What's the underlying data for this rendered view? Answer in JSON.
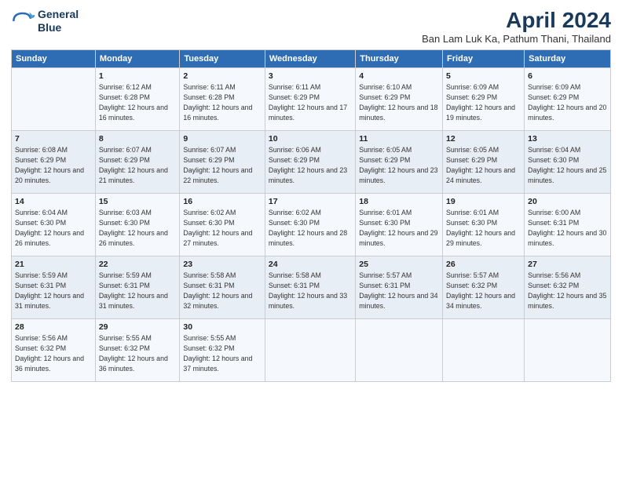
{
  "logo": {
    "line1": "General",
    "line2": "Blue"
  },
  "title": "April 2024",
  "subtitle": "Ban Lam Luk Ka, Pathum Thani, Thailand",
  "days_of_week": [
    "Sunday",
    "Monday",
    "Tuesday",
    "Wednesday",
    "Thursday",
    "Friday",
    "Saturday"
  ],
  "weeks": [
    [
      {
        "day": null,
        "info": null
      },
      {
        "day": "1",
        "sunrise": "6:12 AM",
        "sunset": "6:28 PM",
        "daylight": "12 hours and 16 minutes."
      },
      {
        "day": "2",
        "sunrise": "6:11 AM",
        "sunset": "6:28 PM",
        "daylight": "12 hours and 16 minutes."
      },
      {
        "day": "3",
        "sunrise": "6:11 AM",
        "sunset": "6:29 PM",
        "daylight": "12 hours and 17 minutes."
      },
      {
        "day": "4",
        "sunrise": "6:10 AM",
        "sunset": "6:29 PM",
        "daylight": "12 hours and 18 minutes."
      },
      {
        "day": "5",
        "sunrise": "6:09 AM",
        "sunset": "6:29 PM",
        "daylight": "12 hours and 19 minutes."
      },
      {
        "day": "6",
        "sunrise": "6:09 AM",
        "sunset": "6:29 PM",
        "daylight": "12 hours and 20 minutes."
      }
    ],
    [
      {
        "day": "7",
        "sunrise": "6:08 AM",
        "sunset": "6:29 PM",
        "daylight": "12 hours and 20 minutes."
      },
      {
        "day": "8",
        "sunrise": "6:07 AM",
        "sunset": "6:29 PM",
        "daylight": "12 hours and 21 minutes."
      },
      {
        "day": "9",
        "sunrise": "6:07 AM",
        "sunset": "6:29 PM",
        "daylight": "12 hours and 22 minutes."
      },
      {
        "day": "10",
        "sunrise": "6:06 AM",
        "sunset": "6:29 PM",
        "daylight": "12 hours and 23 minutes."
      },
      {
        "day": "11",
        "sunrise": "6:05 AM",
        "sunset": "6:29 PM",
        "daylight": "12 hours and 23 minutes."
      },
      {
        "day": "12",
        "sunrise": "6:05 AM",
        "sunset": "6:29 PM",
        "daylight": "12 hours and 24 minutes."
      },
      {
        "day": "13",
        "sunrise": "6:04 AM",
        "sunset": "6:30 PM",
        "daylight": "12 hours and 25 minutes."
      }
    ],
    [
      {
        "day": "14",
        "sunrise": "6:04 AM",
        "sunset": "6:30 PM",
        "daylight": "12 hours and 26 minutes."
      },
      {
        "day": "15",
        "sunrise": "6:03 AM",
        "sunset": "6:30 PM",
        "daylight": "12 hours and 26 minutes."
      },
      {
        "day": "16",
        "sunrise": "6:02 AM",
        "sunset": "6:30 PM",
        "daylight": "12 hours and 27 minutes."
      },
      {
        "day": "17",
        "sunrise": "6:02 AM",
        "sunset": "6:30 PM",
        "daylight": "12 hours and 28 minutes."
      },
      {
        "day": "18",
        "sunrise": "6:01 AM",
        "sunset": "6:30 PM",
        "daylight": "12 hours and 29 minutes."
      },
      {
        "day": "19",
        "sunrise": "6:01 AM",
        "sunset": "6:30 PM",
        "daylight": "12 hours and 29 minutes."
      },
      {
        "day": "20",
        "sunrise": "6:00 AM",
        "sunset": "6:31 PM",
        "daylight": "12 hours and 30 minutes."
      }
    ],
    [
      {
        "day": "21",
        "sunrise": "5:59 AM",
        "sunset": "6:31 PM",
        "daylight": "12 hours and 31 minutes."
      },
      {
        "day": "22",
        "sunrise": "5:59 AM",
        "sunset": "6:31 PM",
        "daylight": "12 hours and 31 minutes."
      },
      {
        "day": "23",
        "sunrise": "5:58 AM",
        "sunset": "6:31 PM",
        "daylight": "12 hours and 32 minutes."
      },
      {
        "day": "24",
        "sunrise": "5:58 AM",
        "sunset": "6:31 PM",
        "daylight": "12 hours and 33 minutes."
      },
      {
        "day": "25",
        "sunrise": "5:57 AM",
        "sunset": "6:31 PM",
        "daylight": "12 hours and 34 minutes."
      },
      {
        "day": "26",
        "sunrise": "5:57 AM",
        "sunset": "6:32 PM",
        "daylight": "12 hours and 34 minutes."
      },
      {
        "day": "27",
        "sunrise": "5:56 AM",
        "sunset": "6:32 PM",
        "daylight": "12 hours and 35 minutes."
      }
    ],
    [
      {
        "day": "28",
        "sunrise": "5:56 AM",
        "sunset": "6:32 PM",
        "daylight": "12 hours and 36 minutes."
      },
      {
        "day": "29",
        "sunrise": "5:55 AM",
        "sunset": "6:32 PM",
        "daylight": "12 hours and 36 minutes."
      },
      {
        "day": "30",
        "sunrise": "5:55 AM",
        "sunset": "6:32 PM",
        "daylight": "12 hours and 37 minutes."
      },
      {
        "day": null,
        "info": null
      },
      {
        "day": null,
        "info": null
      },
      {
        "day": null,
        "info": null
      },
      {
        "day": null,
        "info": null
      }
    ]
  ]
}
